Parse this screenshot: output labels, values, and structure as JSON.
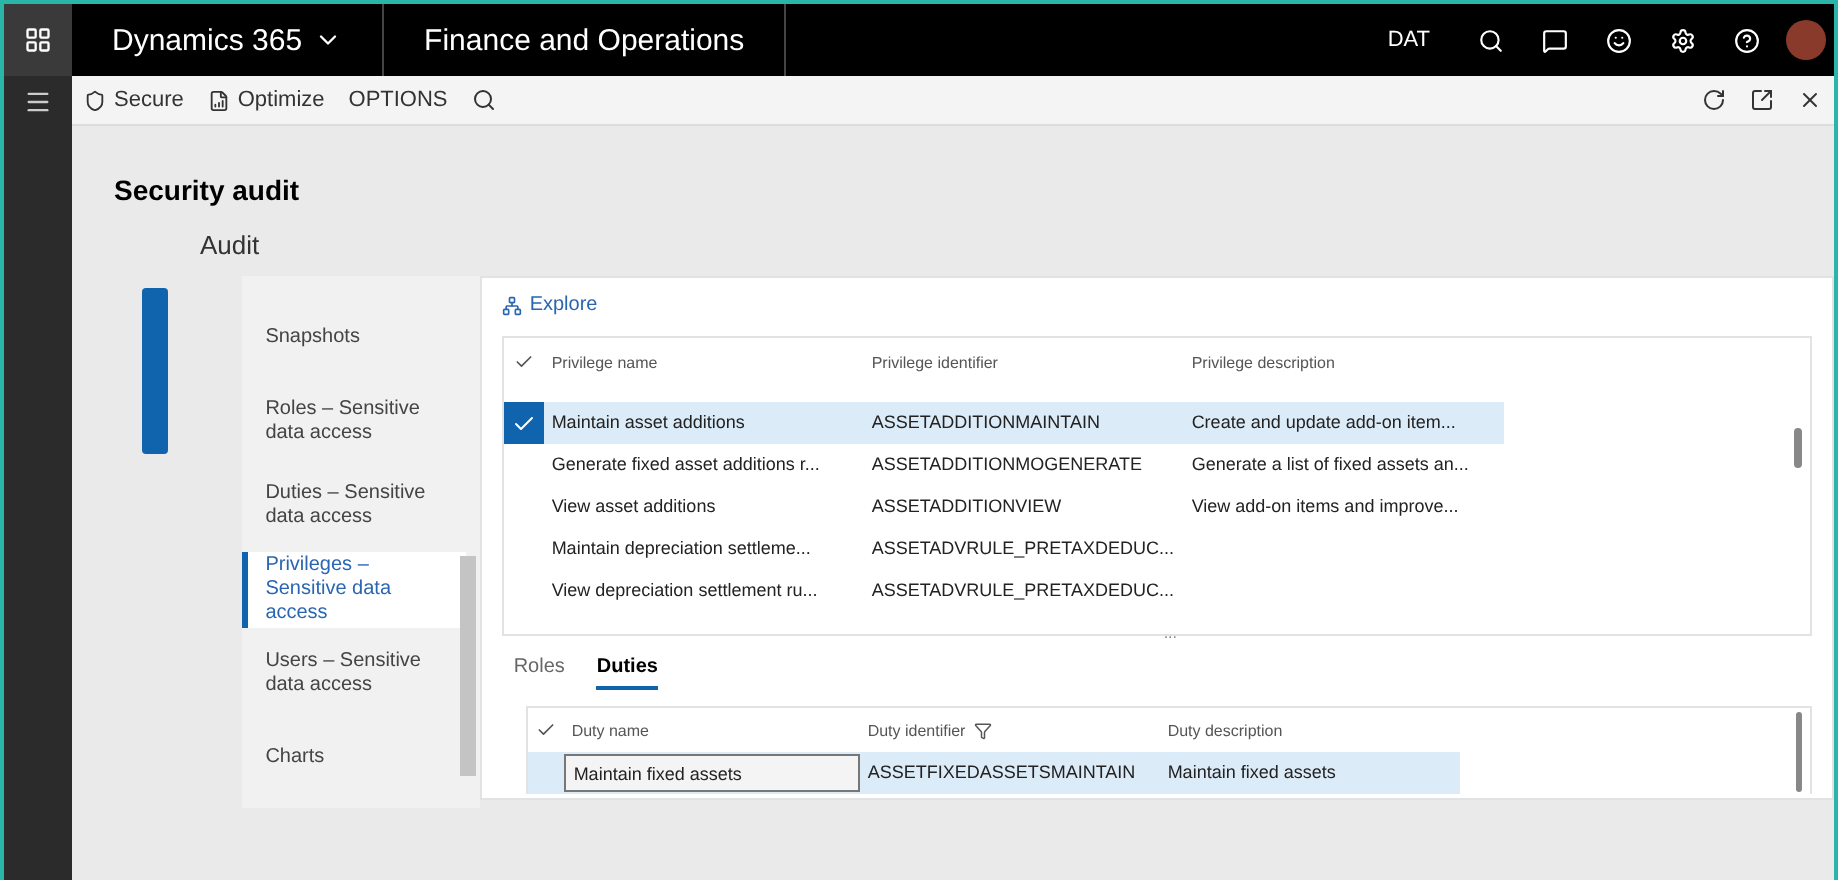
{
  "top_bar": {
    "app": "Dynamics 365",
    "module": "Finance and Operations",
    "company": "DAT"
  },
  "toolbar": {
    "items": [
      "Secure",
      "Optimize",
      "OPTIONS"
    ]
  },
  "page": {
    "title": "Security audit",
    "subtitle": "Audit"
  },
  "nav": {
    "items": [
      {
        "label": "Snapshots",
        "selected": false
      },
      {
        "label": "Roles – Sensitive data access",
        "selected": false
      },
      {
        "label": "Duties – Sensitive data access",
        "selected": false
      },
      {
        "label": "Privileges – Sensitive data access",
        "selected": true
      },
      {
        "label": "Users – Sensitive data access",
        "selected": false
      },
      {
        "label": "Charts",
        "selected": false
      }
    ]
  },
  "explore": "Explore",
  "privileges": {
    "columns": [
      "Privilege name",
      "Privilege identifier",
      "Privilege description"
    ],
    "rows": [
      {
        "cells": [
          "Maintain asset additions",
          "ASSETADDITIONMAINTAIN",
          "Create and update add-on item..."
        ],
        "selected": true
      },
      {
        "cells": [
          "Generate fixed asset additions r...",
          "ASSETADDITIONMOGENERATE",
          "Generate a list of fixed assets an..."
        ],
        "selected": false
      },
      {
        "cells": [
          "View asset additions",
          "ASSETADDITIONVIEW",
          "View add-on items and improve..."
        ],
        "selected": false
      },
      {
        "cells": [
          "Maintain depreciation settleme...",
          "ASSETADVRULE_PRETAXDEDUC...",
          ""
        ],
        "selected": false
      },
      {
        "cells": [
          "View depreciation settlement ru...",
          "ASSETADVRULE_PRETAXDEDUC...",
          ""
        ],
        "selected": false
      }
    ],
    "more": "..."
  },
  "tabs": [
    {
      "label": "Roles",
      "selected": false
    },
    {
      "label": "Duties",
      "selected": true
    }
  ],
  "duties": {
    "columns": [
      "Duty name",
      "Duty identifier",
      "Duty description"
    ],
    "rows": [
      {
        "cells": [
          "Maintain fixed assets",
          "ASSETFIXEDASSETSMAINTAIN",
          "Maintain fixed assets"
        ],
        "selected": true
      }
    ]
  }
}
